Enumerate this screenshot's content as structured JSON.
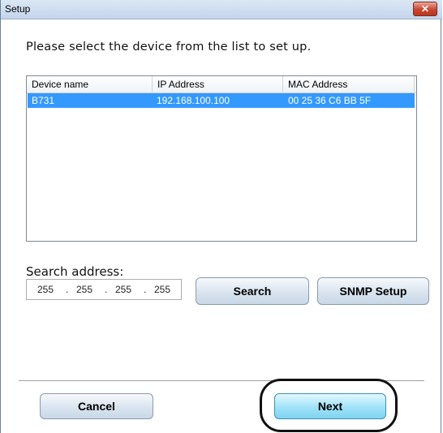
{
  "window": {
    "title": "Setup",
    "close_label": "✕"
  },
  "instruction": "Please select the device from the list to set up.",
  "device_list": {
    "columns": [
      "Device name",
      "IP Address",
      "MAC Address"
    ],
    "rows": [
      {
        "name": "B731",
        "ip": "192.168.100.100",
        "mac": "00 25 36 C6 BB 5F",
        "selected": true
      }
    ]
  },
  "search": {
    "label": "Search address:",
    "octets": [
      "255",
      "255",
      "255",
      "255"
    ],
    "search_button": "Search",
    "snmp_button": "SNMP Setup"
  },
  "footer": {
    "cancel_button": "Cancel",
    "next_button": "Next"
  },
  "colors": {
    "selection": "#3399ff",
    "next_accent": "#9fe3f8",
    "close_red": "#c7462f"
  }
}
